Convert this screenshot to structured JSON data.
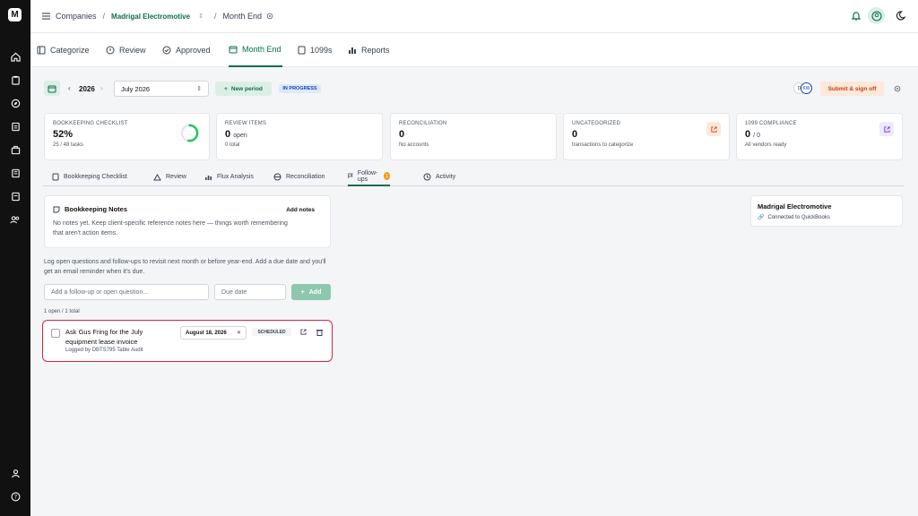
{
  "header": {
    "crumb1": "Companies",
    "company": "Madrigal Electromotive",
    "page": "Month End"
  },
  "nav": {
    "tabs": [
      "Categorize",
      "Review",
      "Approved",
      "Month End",
      "1099s",
      "Reports"
    ],
    "active": "Month End"
  },
  "period": {
    "year": "2026",
    "month": "July 2026",
    "new_period": "New period",
    "status": "IN PROGRESS",
    "avatars": [
      "D",
      "KW"
    ],
    "submit": "Submit & sign off"
  },
  "stats": [
    {
      "label": "BOOKKEEPING CHECKLIST",
      "value": "52%",
      "unit": "",
      "sub": "25 / 48 tasks",
      "progress": 0.52
    },
    {
      "label": "REVIEW ITEMS",
      "value": "0",
      "unit": "open",
      "sub": "0 total"
    },
    {
      "label": "RECONCILIATION",
      "value": "0",
      "unit": "",
      "sub": "No accounts"
    },
    {
      "label": "UNCATEGORIZED",
      "value": "0",
      "unit": "",
      "sub": "transactions to categorize"
    },
    {
      "label": "1099 COMPLIANCE",
      "value": "0",
      "unit": "/ 0",
      "sub": "All vendors ready"
    }
  ],
  "subtabs": {
    "items": [
      "Bookkeeping Checklist",
      "Review",
      "Flux Analysis",
      "Reconciliation",
      "Follow-ups",
      "Activity"
    ],
    "followups_badge": "1"
  },
  "notes": {
    "title": "Bookkeeping Notes",
    "add": "Add notes",
    "empty": "No notes yet. Keep client-specific reference notes here — things worth remembering that aren't action items."
  },
  "followups": {
    "intro": "Log open questions and follow-ups to revisit next month or before year-end. Add a due date and you'll get an email reminder when it's due.",
    "placeholder": "Add a follow-up or open question...",
    "due_placeholder": "Due date",
    "add": "Add",
    "count": "1 open / 1 total"
  },
  "item": {
    "text": "Ask Gus Fring for the July equipment lease invoice",
    "logged": "Logged by DBTS795 Table Audit",
    "date": "August 18, 2026",
    "status": "SCHEDULED"
  },
  "side": {
    "company": "Madrigal Electromotive",
    "connection": "Connected to QuickBooks"
  },
  "colors": {
    "accent": "#0b6e4f",
    "highlight": "#d7263d"
  }
}
